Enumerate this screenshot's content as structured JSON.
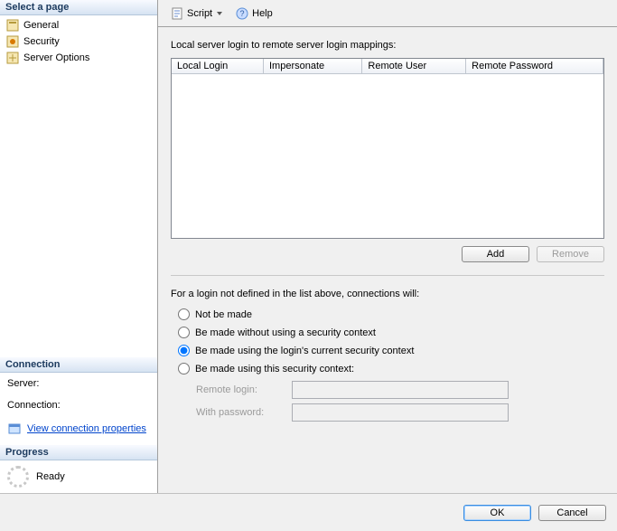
{
  "sidebar": {
    "select_page_header": "Select a page",
    "pages": [
      {
        "label": "General"
      },
      {
        "label": "Security"
      },
      {
        "label": "Server Options"
      }
    ],
    "connection_header": "Connection",
    "server_label": "Server:",
    "server_value": "",
    "connection_label": "Connection:",
    "connection_value": "",
    "view_conn_props": "View connection properties",
    "progress_header": "Progress",
    "progress_status": "Ready"
  },
  "toolbar": {
    "script_label": "Script",
    "help_label": "Help"
  },
  "content": {
    "mappings_label": "Local server login to remote server login mappings:",
    "columns": [
      "Local Login",
      "Impersonate",
      "Remote User",
      "Remote Password"
    ],
    "rows": [],
    "add_label": "Add",
    "remove_label": "Remove",
    "not_defined_label": "For a login not defined in the list above, connections will:",
    "radios": {
      "not_made": "Not be made",
      "no_context": "Be made without using a security context",
      "current_context": "Be made using the login's current security context",
      "this_context": "Be made using this security context:",
      "selected": "current_context"
    },
    "remote_login_label": "Remote login:",
    "remote_login_value": "",
    "with_password_label": "With password:",
    "with_password_value": ""
  },
  "footer": {
    "ok": "OK",
    "cancel": "Cancel"
  }
}
